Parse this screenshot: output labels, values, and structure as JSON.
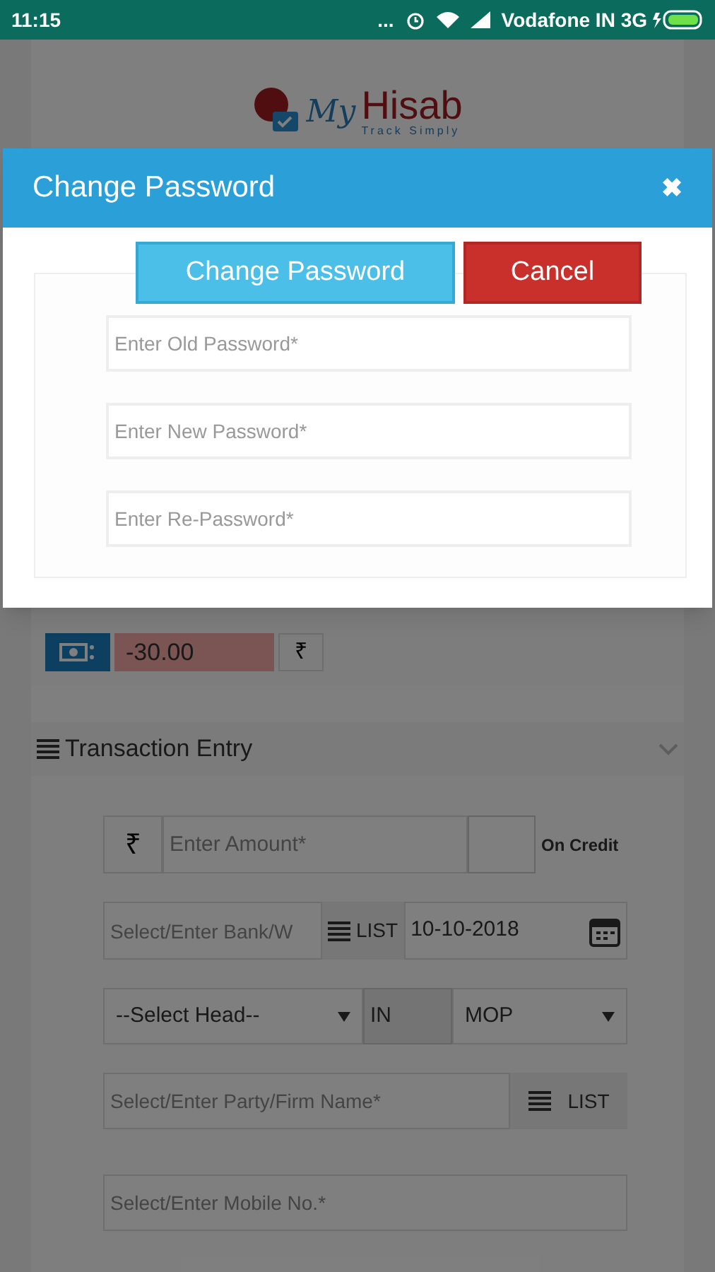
{
  "status_bar": {
    "time": "11:15",
    "dots": "...",
    "carrier": "Vodafone IN 3G"
  },
  "logo": {
    "script": "My",
    "name": "Hisab",
    "tagline": "Track Simply"
  },
  "balance": {
    "amount": "-30.00",
    "currency": "₹"
  },
  "transaction_entry": {
    "title": "Transaction Entry",
    "amount": {
      "currency": "₹",
      "placeholder": "Enter Amount*",
      "on_credit": "On Credit",
      "checked": false
    },
    "bank": {
      "placeholder": "Select/Enter Bank/W",
      "list": "LIST",
      "date": "10-10-2018"
    },
    "head": {
      "value": "--Select Head--",
      "type": "IN",
      "mop": "MOP"
    },
    "party": {
      "placeholder": "Select/Enter Party/Firm Name*",
      "list": "LIST"
    },
    "mobile": {
      "placeholder": "Select/Enter Mobile No.*"
    }
  },
  "dialog": {
    "title": "Change Password",
    "close": "✖",
    "buttons": [
      {
        "label": "Change Password",
        "kind": "primary"
      },
      {
        "label": "Cancel",
        "kind": "danger"
      }
    ],
    "fields": [
      {
        "placeholder": "Enter Old Password*"
      },
      {
        "placeholder": "Enter New Password*"
      },
      {
        "placeholder": "Enter Re-Password*"
      }
    ]
  }
}
